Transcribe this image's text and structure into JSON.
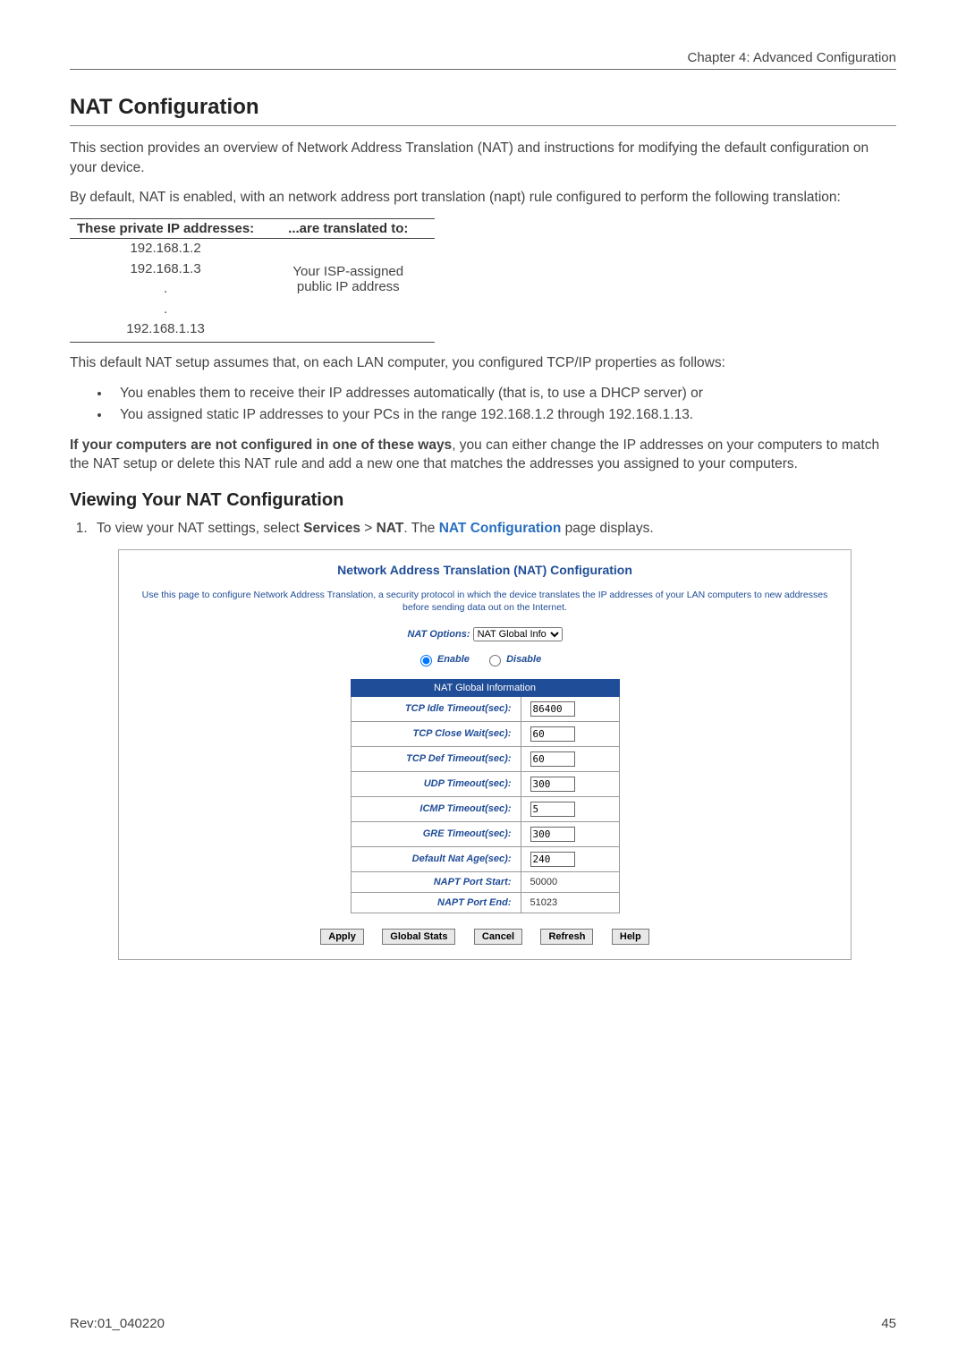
{
  "header": {
    "chapter": "Chapter 4: Advanced Configuration"
  },
  "section": {
    "title": "NAT Configuration",
    "p1": "This section provides an overview of Network Address Translation (NAT) and instructions for modifying the default configuration on your device.",
    "p2": "By default, NAT is enabled, with an network address port translation (napt) rule configured to perform the following translation:"
  },
  "table1": {
    "h1": "These private IP addresses:",
    "h2": "...are translated to:",
    "ips": [
      "192.168.1.2",
      "192.168.1.3",
      ".",
      ".",
      "192.168.1.13"
    ],
    "right1": "Your ISP-assigned",
    "right2": "public IP address"
  },
  "p_after_table": "This default NAT setup assumes that, on each LAN computer, you configured TCP/IP properties as follows:",
  "bullets": [
    "You enables them to receive their IP addresses automatically (that is, to use a DHCP server) or",
    "You assigned static IP addresses to your PCs in the range 192.168.1.2 through 192.168.1.13."
  ],
  "p_if_not_1": "If your computers are not configured in one of these ways",
  "p_if_not_2": ", you can either change the IP addresses on your computers to match the NAT setup or delete this NAT rule and add a new one that matches the addresses you assigned to your computers.",
  "sub": {
    "title": "Viewing Your NAT Configuration",
    "step1_a": "To view your NAT settings, select ",
    "step1_b": "Services",
    "step1_c": " > ",
    "step1_d": "NAT",
    "step1_e": ". The ",
    "step1_f": "NAT Configuration",
    "step1_g": " page displays."
  },
  "screenshot": {
    "title": "Network Address Translation (NAT) Configuration",
    "desc": "Use this page to configure Network Address Translation, a security protocol in which the device translates the IP addresses of your LAN computers to new addresses before sending data out on the Internet.",
    "nat_options_label": "NAT Options:",
    "nat_options_value": "NAT Global Info",
    "radio_enable": "Enable",
    "radio_disable": "Disable",
    "table_header": "NAT Global Information",
    "rows": [
      {
        "k": "TCP Idle Timeout(sec):",
        "v": "86400",
        "editable": true
      },
      {
        "k": "TCP Close Wait(sec):",
        "v": "60",
        "editable": true
      },
      {
        "k": "TCP Def Timeout(sec):",
        "v": "60",
        "editable": true
      },
      {
        "k": "UDP Timeout(sec):",
        "v": "300",
        "editable": true
      },
      {
        "k": "ICMP Timeout(sec):",
        "v": "5",
        "editable": true
      },
      {
        "k": "GRE Timeout(sec):",
        "v": "300",
        "editable": true
      },
      {
        "k": "Default Nat Age(sec):",
        "v": "240",
        "editable": true
      },
      {
        "k": "NAPT Port Start:",
        "v": "50000",
        "editable": false
      },
      {
        "k": "NAPT Port End:",
        "v": "51023",
        "editable": false
      }
    ],
    "buttons": {
      "apply": "Apply",
      "global_stats": "Global Stats",
      "cancel": "Cancel",
      "refresh": "Refresh",
      "help": "Help"
    }
  },
  "footer": {
    "rev": "Rev:01_040220",
    "page": "45"
  }
}
